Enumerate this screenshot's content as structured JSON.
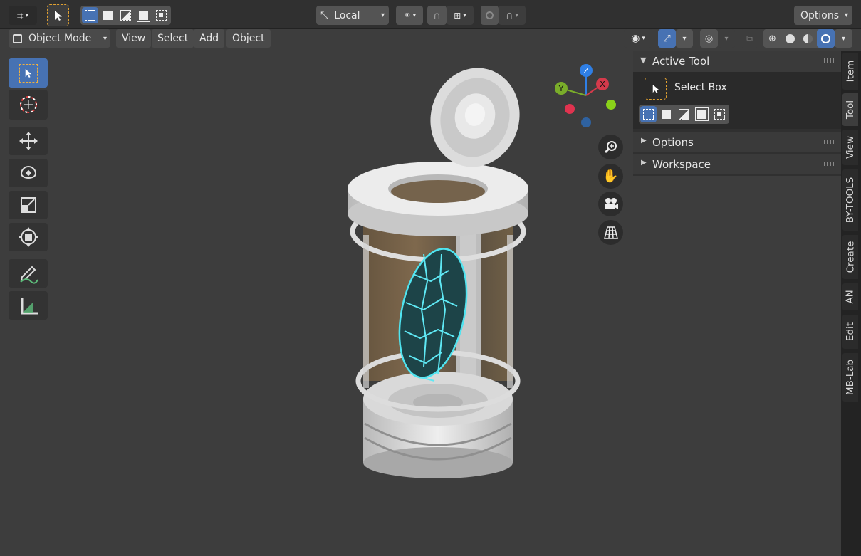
{
  "header": {
    "orientation_dropdown": "Local",
    "options_label": "Options"
  },
  "viewport_header": {
    "mode_label": "Object Mode",
    "menus": [
      "View",
      "Select",
      "Add",
      "Object"
    ]
  },
  "gizmo": {
    "axes": {
      "z": "Z",
      "y": "Y",
      "x": "X"
    },
    "colors": {
      "x": "#d43a4b",
      "y": "#7aad2a",
      "z": "#2f7fe5"
    }
  },
  "sidebar": {
    "active_tool_title": "Active Tool",
    "tool_name": "Select Box",
    "panels": [
      "Options",
      "Workspace"
    ],
    "tabs": [
      "Item",
      "Tool",
      "View",
      "BY-TOOLS",
      "Create",
      "AN",
      "Edit",
      "MB-Lab"
    ],
    "active_tab": "Tool"
  },
  "toolbar": {
    "tools": [
      "select-box",
      "cursor",
      "move",
      "rotate",
      "scale",
      "transform",
      "annotate",
      "measure"
    ]
  },
  "colors": {
    "accent_blue": "#4772b3",
    "viewport_bg": "#3d3d3d",
    "header_bg": "#303030",
    "hologram": "#4fe4f0"
  }
}
